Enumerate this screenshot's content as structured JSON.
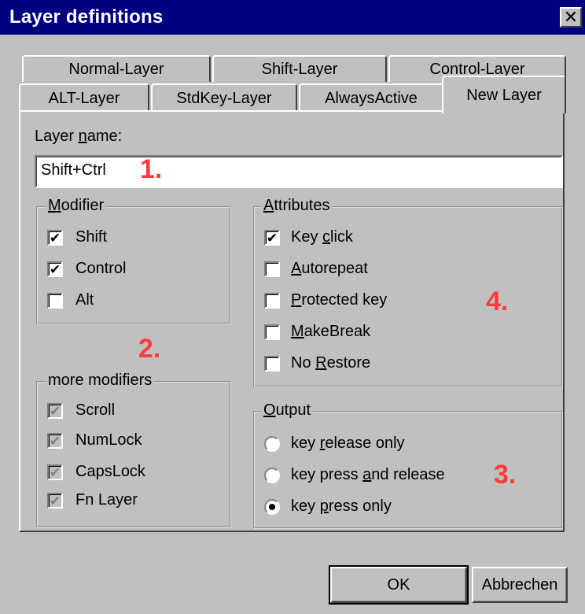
{
  "window": {
    "title": "Layer definitions",
    "close_glyph": "✕",
    "close_icon": "close-icon"
  },
  "tabs": {
    "row_back": [
      "Normal-Layer",
      "Shift-Layer",
      "Control-Layer"
    ],
    "row_front": [
      "ALT-Layer",
      "StdKey-Layer",
      "AlwaysActive",
      "New Layer"
    ],
    "active": "New Layer"
  },
  "layer_name": {
    "label_prefix": "Layer ",
    "label_mnemonic": "n",
    "label_suffix": "ame:",
    "value": "Shift+Ctrl"
  },
  "modifier": {
    "title_mnemonic": "M",
    "title_rest": "odifier",
    "items": [
      {
        "label": "Shift",
        "checked": true
      },
      {
        "label": "Control",
        "checked": true
      },
      {
        "label": "Alt",
        "checked": false
      }
    ]
  },
  "more_modifiers": {
    "title": "more modifiers",
    "items": [
      {
        "label": "Scroll",
        "checked": true,
        "disabled": true
      },
      {
        "label": "NumLock",
        "checked": true,
        "disabled": true
      },
      {
        "label": "CapsLock",
        "checked": true,
        "disabled": true
      },
      {
        "label": "Fn Layer",
        "checked": true,
        "disabled": true
      }
    ]
  },
  "attributes": {
    "title_mnemonic": "A",
    "title_rest": "ttributes",
    "items": [
      {
        "pre": "Key ",
        "mn": "c",
        "post": "lick",
        "checked": true
      },
      {
        "pre": "",
        "mn": "A",
        "post": "utorepeat",
        "checked": false
      },
      {
        "pre": "",
        "mn": "P",
        "post": "rotected key",
        "checked": false
      },
      {
        "pre": "",
        "mn": "M",
        "post": "akeBreak",
        "checked": false
      },
      {
        "pre": "No ",
        "mn": "R",
        "post": "estore",
        "checked": false
      }
    ]
  },
  "output": {
    "title_mnemonic": "O",
    "title_rest": "utput",
    "items": [
      {
        "pre": "key ",
        "mn": "r",
        "post": "elease only",
        "selected": false
      },
      {
        "pre": "key press ",
        "mn": "a",
        "post": "nd release",
        "selected": false
      },
      {
        "pre": "key ",
        "mn": "p",
        "post": "ress only",
        "selected": true
      }
    ]
  },
  "annotations": {
    "n1": "1.",
    "n2": "2.",
    "n3": "3.",
    "n4": "4.",
    "color": "#ff3b3b"
  },
  "buttons": {
    "ok": "OK",
    "cancel": "Abbrechen"
  },
  "check_glyph": "✔"
}
